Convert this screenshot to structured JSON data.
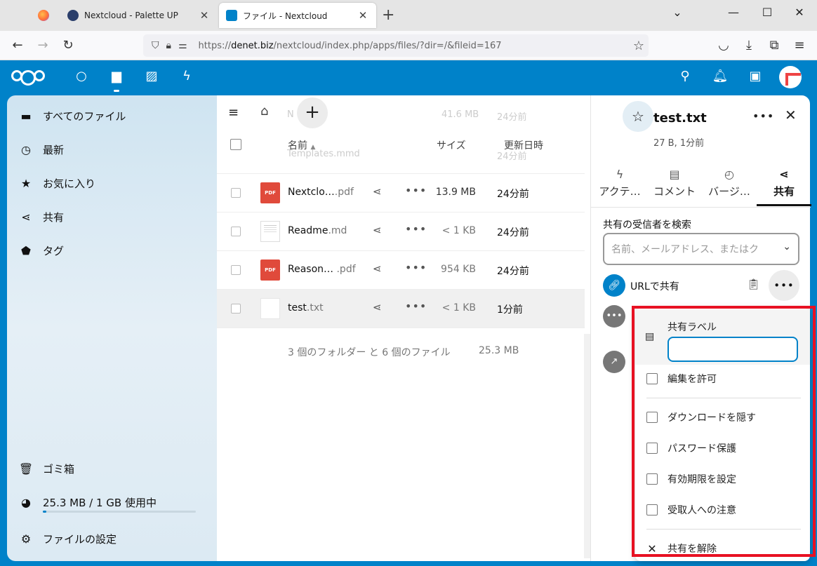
{
  "browser": {
    "tabs": [
      {
        "label": ""
      },
      {
        "label": "Nextcloud - Palette UP"
      },
      {
        "label": "ファイル - Nextcloud"
      }
    ],
    "new_tab": "+",
    "url_prefix": "https://",
    "url_host": "denet.biz",
    "url_path": "/nextcloud/index.php/apps/files/?dir=/&fileid=167"
  },
  "sidebar": {
    "items": [
      {
        "label": "すべてのファイル",
        "icon": "folder-icon"
      },
      {
        "label": "最新",
        "icon": "clock-icon"
      },
      {
        "label": "お気に入り",
        "icon": "star-icon"
      },
      {
        "label": "共有",
        "icon": "share-icon"
      },
      {
        "label": "タグ",
        "icon": "tag-icon"
      }
    ],
    "trash": "ゴミ箱",
    "quota": "25.3 MB / 1 GB 使用中",
    "quota_used_fraction": 0.025,
    "settings": "ファイルの設定"
  },
  "filelist": {
    "ghost_rows": [
      {
        "time": "24分前",
        "size": "41.6 MB",
        "name": "N"
      },
      {
        "time": "24分前",
        "name": "Templates.mmd"
      }
    ],
    "columns": {
      "name": "名前",
      "size": "サイズ",
      "modified": "更新日時"
    },
    "rows": [
      {
        "base": "Nextclo…",
        "ext": ".pdf",
        "size": "13.9 MB",
        "modified": "24分前",
        "type": "pdf"
      },
      {
        "base": "Readme",
        "ext": ".md",
        "size": "< 1 KB",
        "modified": "24分前",
        "type": "doc"
      },
      {
        "base": "Reason…",
        "ext": " .pdf",
        "size": "954 KB",
        "modified": "24分前",
        "type": "pdf"
      },
      {
        "base": "test",
        "ext": ".txt",
        "size": "< 1 KB",
        "modified": "1分前",
        "type": "txt"
      }
    ],
    "pdf_badge": "PDF",
    "summary_text": "3 個のフォルダー と 6 個のファイル",
    "summary_size": "25.3 MB"
  },
  "details": {
    "file_name": "test.txt",
    "file_meta": "27 B, 1分前",
    "tabs": [
      {
        "label": "アクテ…",
        "icon": "activity-icon"
      },
      {
        "label": "コメント",
        "icon": "comment-icon"
      },
      {
        "label": "バージ…",
        "icon": "history-icon"
      },
      {
        "label": "共有",
        "icon": "share-icon"
      }
    ],
    "recipient_label": "共有の受信者を検索",
    "recipient_placeholder": "名前、メールアドレス、またはク",
    "url_share": "URLで共有"
  },
  "menu": {
    "label_title": "共有ラベル",
    "label_value": "",
    "allow_edit": "編集を許可",
    "hide_download": "ダウンロードを隠す",
    "password": "パスワード保護",
    "expiration": "有効期限を設定",
    "note": "受取人への注意",
    "unshare": "共有を解除"
  },
  "colors": {
    "brand": "#0082c9",
    "highlight": "#e81123",
    "pdf": "#e04a3b"
  }
}
